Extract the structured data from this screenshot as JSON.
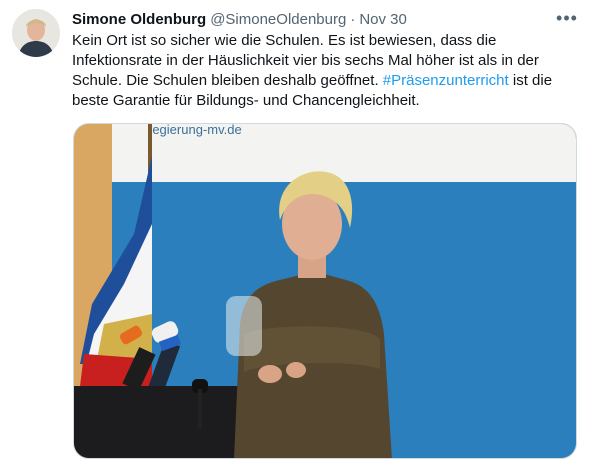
{
  "tweet": {
    "author_name": "Simone Oldenburg",
    "handle": "@SimoneOldenburg",
    "separator": "·",
    "date": "Nov 30",
    "more_label": "•••",
    "text_part1": "Kein Ort ist so sicher wie die Schulen. Es ist bewiesen, dass die Infektionsrate in der Häuslichkeit vier bis sechs Mal höher ist als in der Schule. Die Schulen bleiben deshalb geöffnet. ",
    "hashtag": "#Präsenzunterricht",
    "text_part2": " ist die beste Garantie für Bildungs- und Chancengleichheit."
  },
  "photo": {
    "banner_text": "regierung-mv.de"
  },
  "colors": {
    "hashtag": "#1d9bf0",
    "name": "#0f1419",
    "secondary": "#536471",
    "backdrop_blue": "#2b7fbd"
  }
}
